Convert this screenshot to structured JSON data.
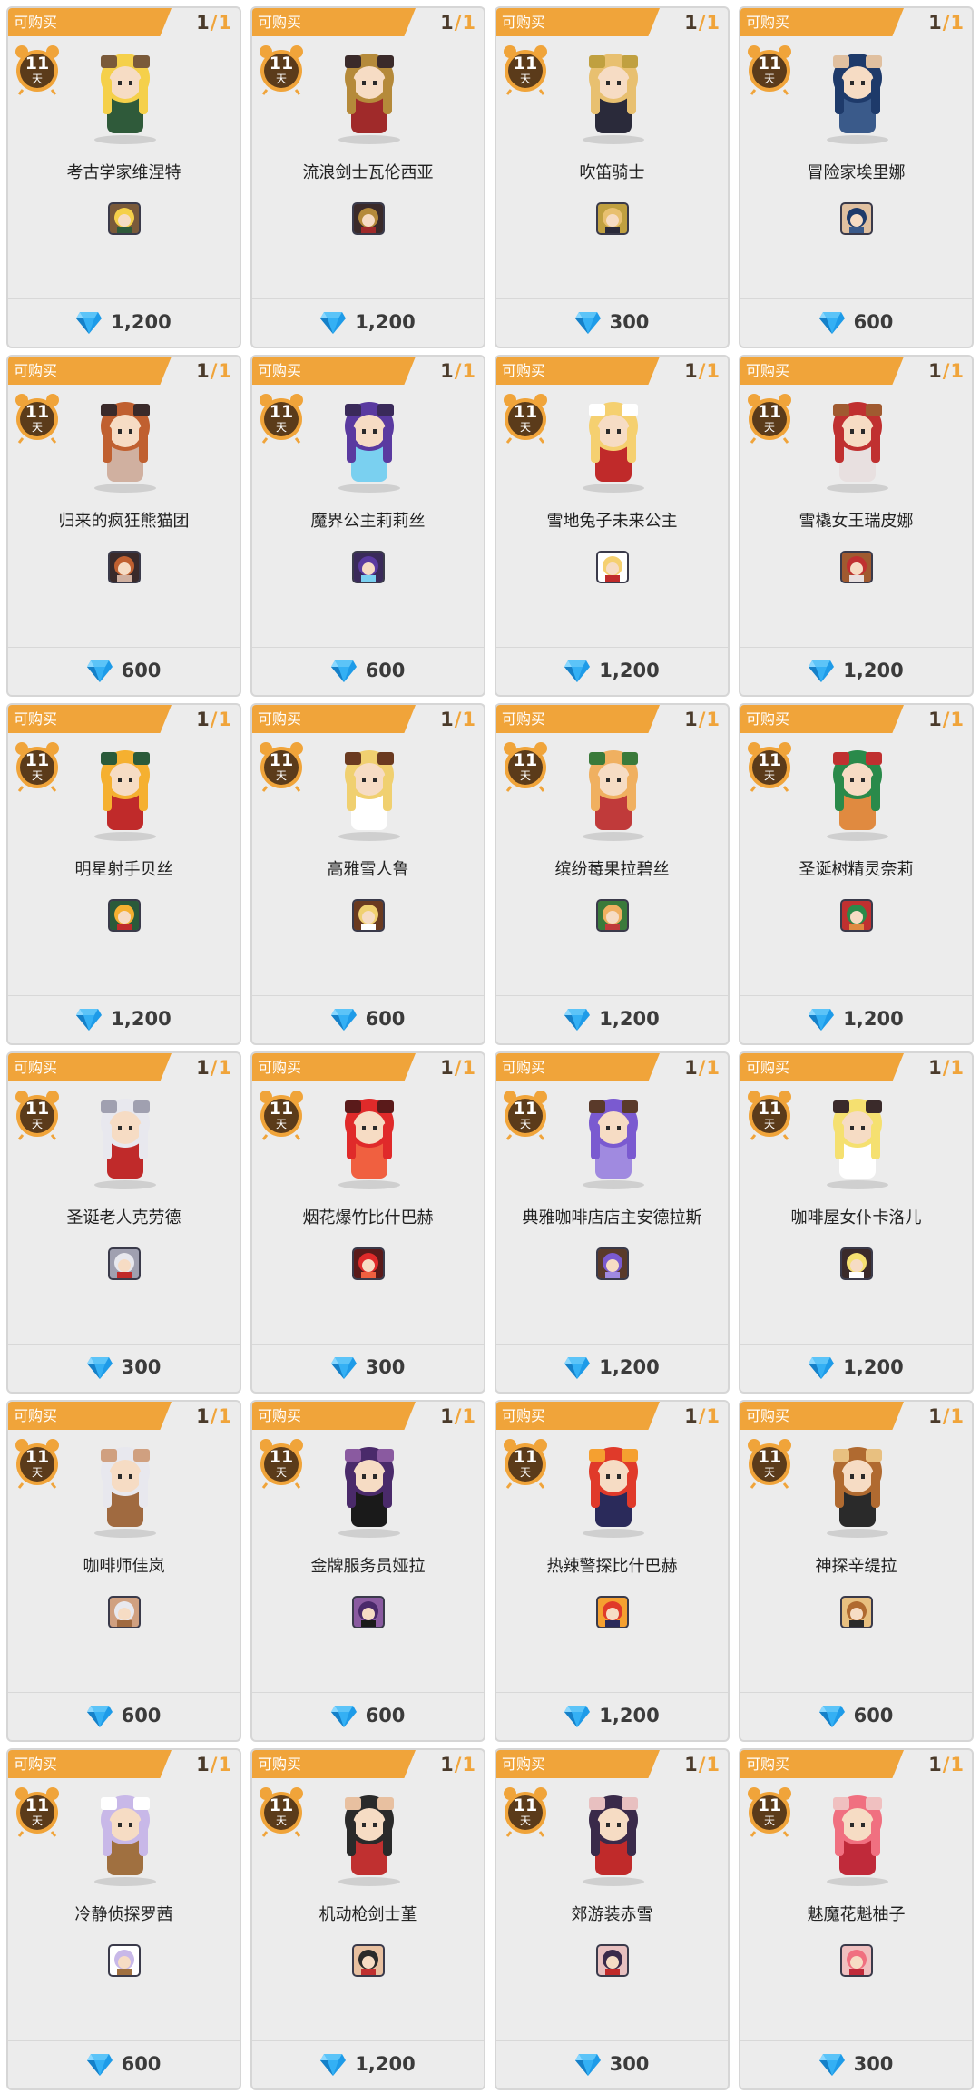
{
  "labels": {
    "available": "可购买",
    "days_unit": "天"
  },
  "colors": {
    "ribbon": "#f0a43a",
    "timer": "#5b3b1a",
    "gem": "#1e9be8",
    "card_bg": "#ececec"
  },
  "items": [
    {
      "name": "考古学家维涅特",
      "price": "1,200",
      "days": "11",
      "count": "1",
      "max": "1",
      "palette": [
        "#f5d04a",
        "#2f5a3a",
        "#7a5a3a"
      ]
    },
    {
      "name": "流浪剑士瓦伦西亚",
      "price": "1,200",
      "days": "11",
      "count": "1",
      "max": "1",
      "palette": [
        "#b58a3a",
        "#a02a2a",
        "#3a2a2a"
      ]
    },
    {
      "name": "吹笛骑士",
      "price": "300",
      "days": "11",
      "count": "1",
      "max": "1",
      "palette": [
        "#e8c070",
        "#2a2a3a",
        "#c0a040"
      ]
    },
    {
      "name": "冒险家埃里娜",
      "price": "600",
      "days": "11",
      "count": "1",
      "max": "1",
      "palette": [
        "#1e3a6a",
        "#3a5a8a",
        "#e0c0a0"
      ]
    },
    {
      "name": "归来的疯狂熊猫团",
      "price": "600",
      "days": "11",
      "count": "1",
      "max": "1",
      "palette": [
        "#c06030",
        "#d0b0a0",
        "#3a2a2a"
      ]
    },
    {
      "name": "魔界公主莉莉丝",
      "price": "600",
      "days": "11",
      "count": "1",
      "max": "1",
      "palette": [
        "#5a3aa0",
        "#7ad0f0",
        "#3a2a5a"
      ]
    },
    {
      "name": "雪地兔子未来公主",
      "price": "1,200",
      "days": "11",
      "count": "1",
      "max": "1",
      "palette": [
        "#f5d070",
        "#c02a2a",
        "#ffffff"
      ]
    },
    {
      "name": "雪橇女王瑞皮娜",
      "price": "1,200",
      "days": "11",
      "count": "1",
      "max": "1",
      "palette": [
        "#c03030",
        "#e8e0e0",
        "#a05a30"
      ]
    },
    {
      "name": "明星射手贝丝",
      "price": "1,200",
      "days": "11",
      "count": "1",
      "max": "1",
      "palette": [
        "#f5b030",
        "#c02a2a",
        "#2a5a3a"
      ]
    },
    {
      "name": "高雅雪人鲁",
      "price": "600",
      "days": "11",
      "count": "1",
      "max": "1",
      "palette": [
        "#f0d070",
        "#ffffff",
        "#6a3a20"
      ]
    },
    {
      "name": "缤纷莓果拉碧丝",
      "price": "1,200",
      "days": "11",
      "count": "1",
      "max": "1",
      "palette": [
        "#f0b060",
        "#c03a3a",
        "#3a7a3a"
      ]
    },
    {
      "name": "圣诞树精灵奈莉",
      "price": "1,200",
      "days": "11",
      "count": "1",
      "max": "1",
      "palette": [
        "#2a8a4a",
        "#e08a40",
        "#c03030"
      ]
    },
    {
      "name": "圣诞老人克劳德",
      "price": "300",
      "days": "11",
      "count": "1",
      "max": "1",
      "palette": [
        "#e8e8ee",
        "#c02a2a",
        "#a0a0b0"
      ]
    },
    {
      "name": "烟花爆竹比什巴赫",
      "price": "300",
      "days": "11",
      "count": "1",
      "max": "1",
      "palette": [
        "#e02a2a",
        "#f06040",
        "#5a1a1a"
      ]
    },
    {
      "name": "典雅咖啡店店主安德拉斯",
      "price": "1,200",
      "days": "11",
      "count": "1",
      "max": "1",
      "palette": [
        "#7a5ad0",
        "#a08ae0",
        "#5a3a2a"
      ]
    },
    {
      "name": "咖啡屋女仆卡洛儿",
      "price": "1,200",
      "days": "11",
      "count": "1",
      "max": "1",
      "palette": [
        "#f5e070",
        "#ffffff",
        "#3a2a2a"
      ]
    },
    {
      "name": "咖啡师佳岚",
      "price": "600",
      "days": "11",
      "count": "1",
      "max": "1",
      "palette": [
        "#e8e8ee",
        "#a06a40",
        "#d0a080"
      ]
    },
    {
      "name": "金牌服务员娅拉",
      "price": "600",
      "days": "11",
      "count": "1",
      "max": "1",
      "palette": [
        "#4a2a6a",
        "#1a1a1a",
        "#8a5aa0"
      ]
    },
    {
      "name": "热辣警探比什巴赫",
      "price": "1,200",
      "days": "11",
      "count": "1",
      "max": "1",
      "palette": [
        "#e03a2a",
        "#2a2a5a",
        "#f5a030"
      ]
    },
    {
      "name": "神探辛缇拉",
      "price": "600",
      "days": "11",
      "count": "1",
      "max": "1",
      "palette": [
        "#b06a30",
        "#2a2a2a",
        "#e8c080"
      ]
    },
    {
      "name": "冷静侦探罗茜",
      "price": "600",
      "days": "11",
      "count": "1",
      "max": "1",
      "palette": [
        "#c8b8e8",
        "#a07040",
        "#ffffff"
      ]
    },
    {
      "name": "机动枪剑士堇",
      "price": "1,200",
      "days": "11",
      "count": "1",
      "max": "1",
      "palette": [
        "#2a2a2a",
        "#c03030",
        "#e8c0a0"
      ]
    },
    {
      "name": "郊游装赤雪",
      "price": "300",
      "days": "11",
      "count": "1",
      "max": "1",
      "palette": [
        "#3a2a4a",
        "#c02a2a",
        "#e8c0c0"
      ]
    },
    {
      "name": "魅魔花魁柚子",
      "price": "300",
      "days": "11",
      "count": "1",
      "max": "1",
      "palette": [
        "#f07080",
        "#c02a3a",
        "#f0c0c0"
      ]
    }
  ]
}
